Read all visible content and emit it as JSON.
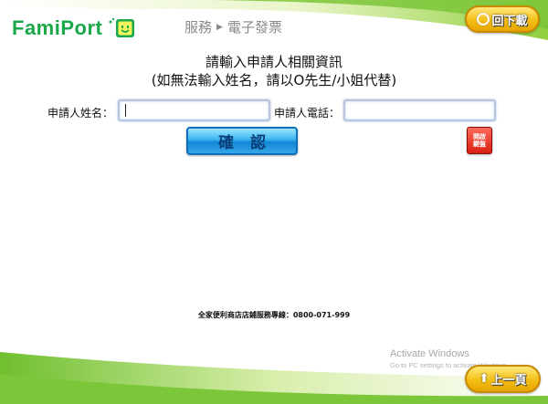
{
  "header": {
    "logo_text": "FamiPort",
    "breadcrumb": [
      "服務",
      "電子發票"
    ],
    "home_button_label": "回下載"
  },
  "main": {
    "title": "請輸入申請人相關資訊",
    "subtitle": "(如無法輸入姓名，請以O先生/小姐代替)",
    "name_label": "申請人姓名：",
    "phone_label": "申請人電話：",
    "name_value": "",
    "phone_value": "",
    "confirm_label": "確認",
    "keyboard_button": [
      "開啟",
      "鍵盤"
    ]
  },
  "footer": {
    "hotline": "全家便利商店店鋪服務專線：0800-071-999",
    "prev_button_label": "上一頁",
    "activate_title": "Activate Windows",
    "activate_sub": "Go to PC settings to activate Windows."
  },
  "colors": {
    "brand_green": "#1aa84a",
    "wave_green": "#7cc63a",
    "button_yellow": "#f4bf16",
    "confirm_blue": "#1287d6",
    "keyboard_red": "#d81e12"
  }
}
